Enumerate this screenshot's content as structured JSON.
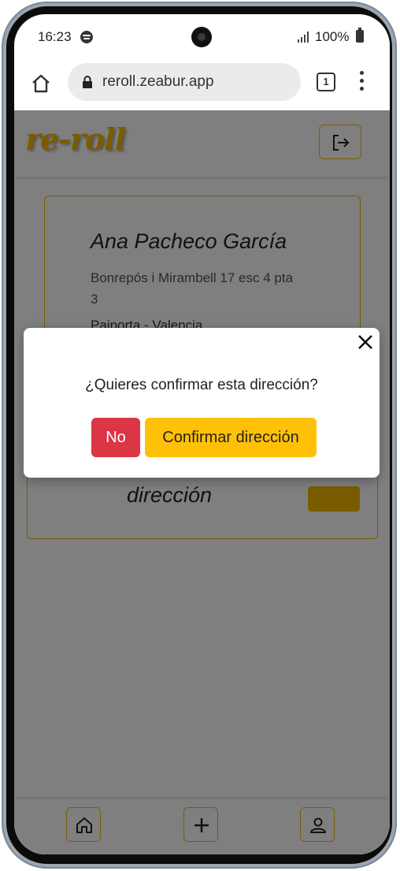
{
  "status_bar": {
    "time": "16:23",
    "battery": "100%",
    "icons": [
      "spotify-icon",
      "camera-icon",
      "signal-icon",
      "battery-icon"
    ]
  },
  "browser": {
    "url": "reroll.zeabur.app",
    "tab_count": "1",
    "icons": [
      "home-icon",
      "lock-icon",
      "tabs-icon",
      "more-menu-icon"
    ]
  },
  "app": {
    "logo": "re-roll",
    "brand_color": "#f5b800"
  },
  "address_card": {
    "name": "Ana Pacheco García",
    "street": "Bonrepós i Mirambell 17 esc 4 pta 3",
    "city": "Paiporta - Valencia"
  },
  "add_card": {
    "label": "dirección"
  },
  "bottom_nav": {
    "items": [
      "home-icon",
      "plus-icon",
      "user-icon"
    ]
  },
  "modal": {
    "message": "¿Quieres confirmar esta dirección?",
    "no_label": "No",
    "confirm_label": "Confirmar dirección",
    "no_color": "#dc3545",
    "confirm_color": "#ffc107"
  }
}
